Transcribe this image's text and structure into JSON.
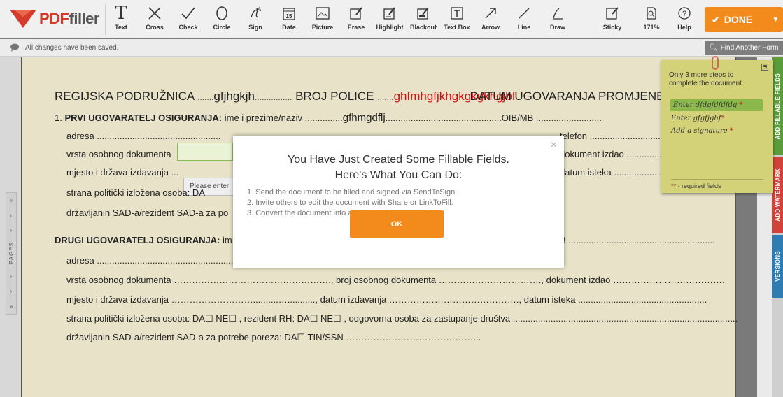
{
  "toolbar": {
    "logo": {
      "pdf": "PDF",
      "filler": "filler"
    },
    "tools": [
      {
        "label": "Text",
        "icon": "text-icon"
      },
      {
        "label": "Cross",
        "icon": "cross-icon"
      },
      {
        "label": "Check",
        "icon": "check-icon"
      },
      {
        "label": "Circle",
        "icon": "circle-icon"
      },
      {
        "label": "Sign",
        "icon": "sign-icon"
      },
      {
        "label": "Date",
        "icon": "date-icon"
      },
      {
        "label": "Picture",
        "icon": "picture-icon"
      },
      {
        "label": "Erase",
        "icon": "erase-icon"
      },
      {
        "label": "Highlight",
        "icon": "highlight-icon"
      },
      {
        "label": "Blackout",
        "icon": "blackout-icon"
      },
      {
        "label": "Text Box",
        "icon": "text-box-icon"
      },
      {
        "label": "Arrow",
        "icon": "arrow-icon"
      },
      {
        "label": "Line",
        "icon": "line-icon"
      },
      {
        "label": "Draw",
        "icon": "draw-icon"
      },
      {
        "label": "Sticky",
        "icon": "sticky-icon"
      },
      {
        "label": "171%",
        "icon": "zoom-icon"
      },
      {
        "label": "Help",
        "icon": "help-icon"
      }
    ],
    "date_glyph": "15",
    "done_label": "DONE"
  },
  "status": {
    "saved_text": "All changes have been saved.",
    "find_form": "Find Another Form"
  },
  "left_panel": {
    "pages_label": "PAGES"
  },
  "right_tabs": {
    "fillable": "ADD FILLABLE FIELDS",
    "watermark": "ADD WATERMARK",
    "versions": "VERSIONS"
  },
  "document": {
    "line1": {
      "a": "REGIJSKA PODRUŽNICA",
      "a_dots": ".......",
      "hand1": "gfjhgkjh",
      "b_dots": "................",
      "b": "BROJ POLICE",
      "c_dots": ".......",
      "hand2": "ghfmhgfjkhgkgkgkhgjbf",
      "c": "DATUM UGOVARANJA PROMJENE",
      "d_dots": "..."
    },
    "s1": {
      "num": "1.",
      "bold": "PRVI UGOVARATELJ OSIGURANJA:",
      "rest": "ime i prezime/naziv ...............",
      "hand": "gfhmgdflj",
      "rest2": "..............................................OIB/MB ..........................",
      "adresa": "adresa .................................................",
      "adresa_r": "telefon ...............................",
      "vrsta": "vrsta osobnog dokumenta",
      "vrsta_r": "dokument izdao ...................",
      "mjesto": "mjesto i država izdavanja ...",
      "mjesto_r": "datum isteka ..........................",
      "strana": "strana politički izložena osoba: DA",
      "drz": "državljanin SAD-a/rezident SAD-a za po"
    },
    "s2": {
      "bold": "DRUGI UGOVARATELJ OSIGURANJA:",
      "bold_rest": "im",
      "oib": "B ..........................................................",
      "adresa": "adresa .....................................................................................................................................................................................",
      "adresa_r": "telefon ...................................................",
      "vrsta": "vrsta osobnog dokumenta ……………………………………………., broj osobnog dokumenta ……………………………., dokument izdao ……………………………….",
      "mjesto": "mjesto i država izdavanja ………………………..........…..........., datum izdavanja ……………………………………., datum isteka ...................................................",
      "strana": "strana politički izložena osoba: DA☐  NE☐ , rezident RH: DA☐  NE☐ , odgovorna osoba za zastupanje društva .........................................................................................",
      "drz": "državljanin SAD-a/rezident SAD-a za potrebe poreza: DA☐        TIN/SSN ……………………………………..."
    },
    "tooltip": "Please enter"
  },
  "modal": {
    "title1": "You Have Just Created Some Fillable Fields.",
    "title2": "Here's What You Can Do:",
    "items": [
      "1. Send the document to be filled and signed via SendToSign.",
      "2. Invite others to edit the document with Share or LinkToFill.",
      "3. Convert the document into a template for easy editing."
    ],
    "ok": "OK",
    "close": "×"
  },
  "sticky": {
    "header": "Only 3 more steps to complete the document.",
    "steps": [
      "Enter dfdgfdfdfdg",
      "Enter gfgfjghf",
      "Add a signature"
    ],
    "required_mark": "*",
    "footer": "* - required fields",
    "minimize": "⊟"
  },
  "colors": {
    "accent": "#f28a1c",
    "brand_red": "#d53b2a",
    "sticky": "#d4d278",
    "active_step": "#8ab84a"
  }
}
